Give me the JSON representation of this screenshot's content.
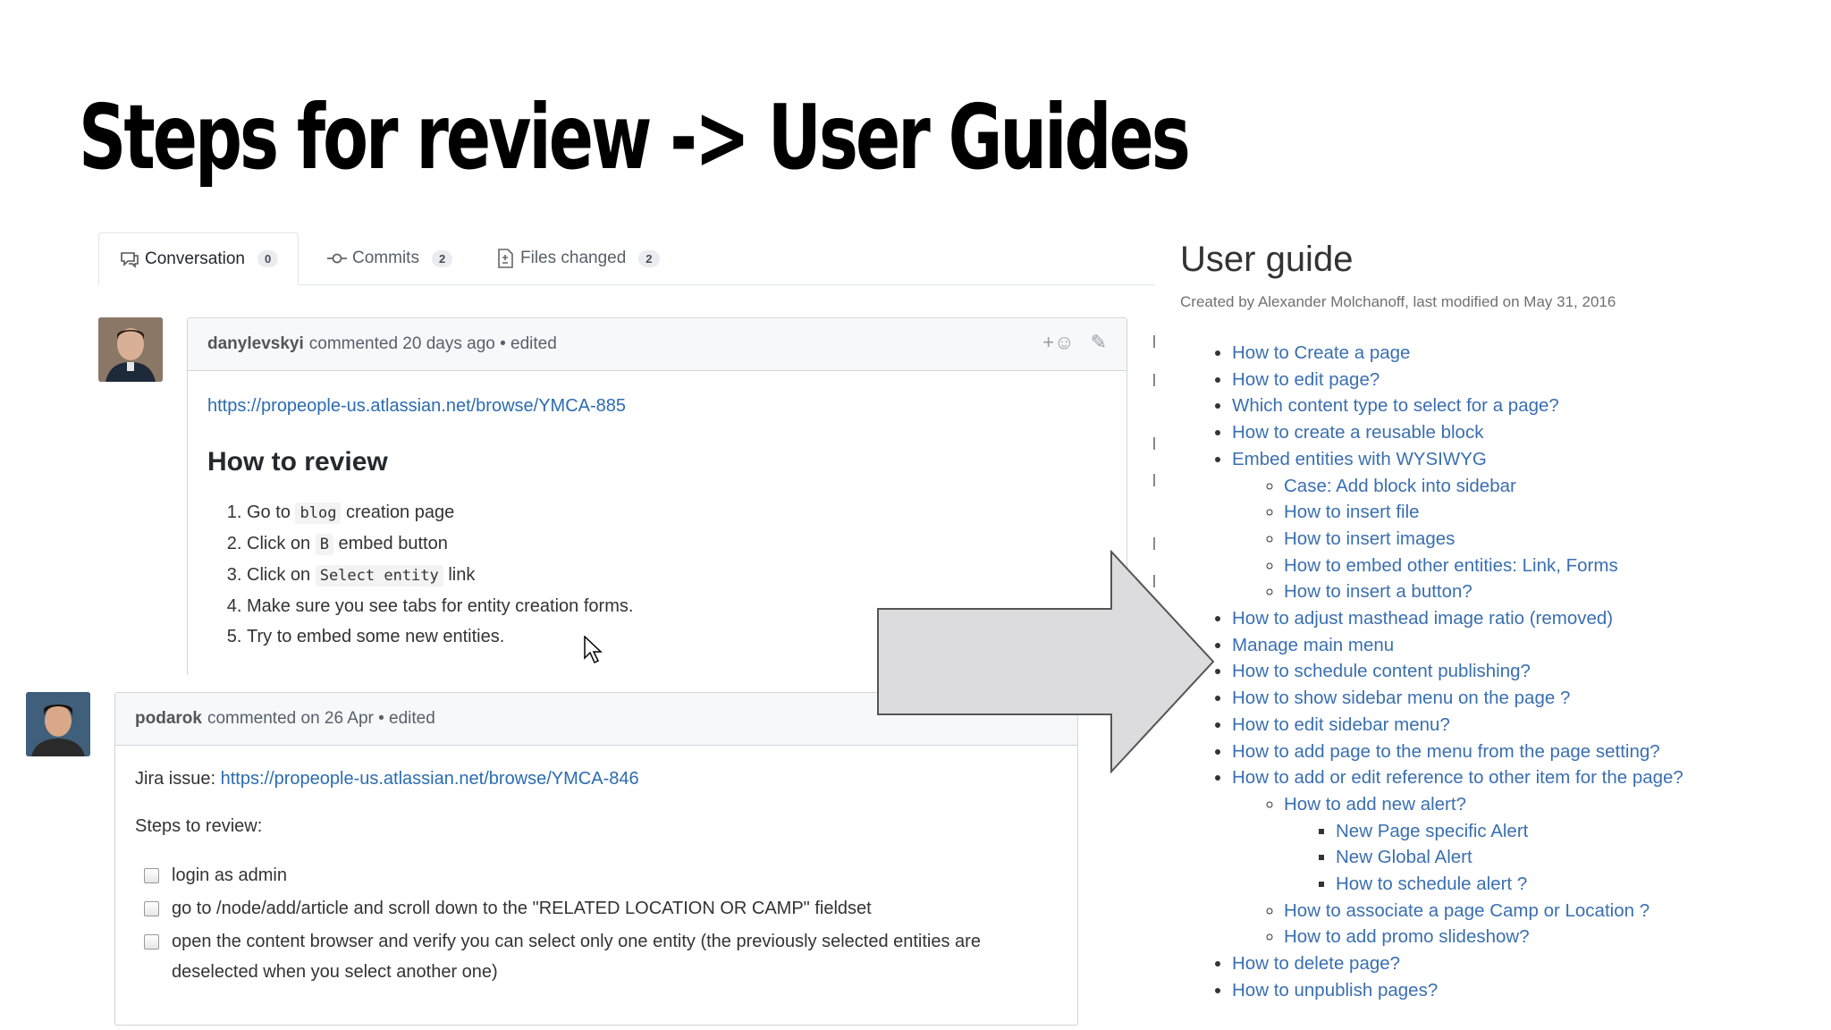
{
  "slide": {
    "title": "Steps for review  -> User Guides"
  },
  "tabs": [
    {
      "label": "Conversation",
      "count": "0"
    },
    {
      "label": "Commits",
      "count": "2"
    },
    {
      "label": "Files changed",
      "count": "2"
    }
  ],
  "comment1": {
    "author": "danylevskyi",
    "meta": "commented 20 days ago • edited",
    "link": "https://propeople-us.atlassian.net/browse/YMCA-885",
    "heading": "How to review",
    "steps": [
      {
        "pre": "Go to ",
        "code": "blog",
        "post": " creation page"
      },
      {
        "pre": "Click on ",
        "code": "B",
        "post": " embed button"
      },
      {
        "pre": "Click on ",
        "code": "Select entity",
        "post": " link"
      },
      {
        "text": "Make sure you see tabs for entity creation forms."
      },
      {
        "text": "Try to embed some new entities."
      }
    ]
  },
  "comment2": {
    "author": "podarok",
    "meta": "commented on 26 Apr • edited",
    "jira_label": "Jira issue: ",
    "jira_link": "https://propeople-us.atlassian.net/browse/YMCA-846",
    "steps_label": "Steps to review:",
    "tasks": [
      "login as admin",
      "go to /node/add/article and scroll down to the \"RELATED LOCATION OR CAMP\" fieldset",
      "open the content browser and verify you can select only one entity (the previously selected entities are deselected when you select another one)"
    ]
  },
  "user_guide": {
    "title": "User guide",
    "meta": "Created by Alexander Molchanoff, last modified on May 31, 2016",
    "items": [
      {
        "label": "How to Create a page",
        "level": 1
      },
      {
        "label": "How to edit page?",
        "level": 1
      },
      {
        "label": "Which content type to select for a page?",
        "level": 1
      },
      {
        "label": "How to create a reusable block",
        "level": 1
      },
      {
        "label": "Embed entities with WYSIWYG",
        "level": 1
      },
      {
        "label": "Case: Add block into sidebar",
        "level": 2
      },
      {
        "label": "How to insert file",
        "level": 2
      },
      {
        "label": "How to insert images",
        "level": 2
      },
      {
        "label": "How to embed other entities:  Link, Forms",
        "level": 2
      },
      {
        "label": "How to insert a button?",
        "level": 2
      },
      {
        "label": "How to adjust masthead image ratio (removed)",
        "level": 1
      },
      {
        "label": "Manage main menu",
        "level": 1
      },
      {
        "label": "How to schedule content publishing?",
        "level": 1
      },
      {
        "label": "How to show sidebar menu on the page ?",
        "level": 1
      },
      {
        "label": "How to edit sidebar menu?",
        "level": 1
      },
      {
        "label": "How to add page to the menu from the page setting?",
        "level": 1
      },
      {
        "label": "How to add or edit reference to other item for the page?",
        "level": 1
      },
      {
        "label": "How to add new alert?",
        "level": 2
      },
      {
        "label": "New Page specific Alert",
        "level": 3
      },
      {
        "label": "New Global Alert",
        "level": 3
      },
      {
        "label": "How to schedule alert ?",
        "level": 3
      },
      {
        "label": "How to associate a page Camp or Location ?",
        "level": 2
      },
      {
        "label": "How to add promo slideshow?",
        "level": 2
      },
      {
        "label": "How to delete page?",
        "level": 1
      },
      {
        "label": "How to unpublish pages?",
        "level": 1
      }
    ]
  },
  "colors": {
    "link": "#2b6cb0",
    "arrow_fill": "#dcdcde",
    "arrow_stroke": "#555555"
  }
}
